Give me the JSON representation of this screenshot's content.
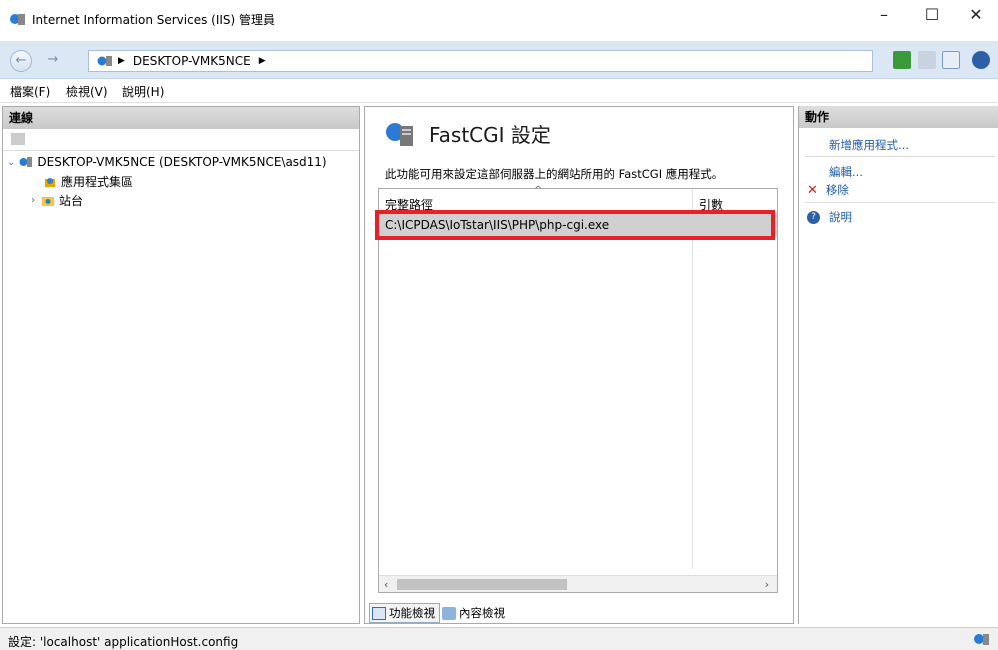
{
  "window": {
    "title": "Internet Information Services (IIS) 管理員"
  },
  "address": {
    "crumb": "DESKTOP-VMK5NCE"
  },
  "menu": [
    "檔案(F)",
    "檢視(V)",
    "說明(H)"
  ],
  "connections": {
    "header": "連線",
    "tree": {
      "server": "DESKTOP-VMK5NCE (DESKTOP-VMK5NCE\\asd11)",
      "app_pools": "應用程式集區",
      "sites": "站台"
    }
  },
  "center": {
    "title": "FastCGI 設定",
    "description": "此功能可用來設定這部伺服器上的網站所用的 FastCGI 應用程式。",
    "columns": [
      "完整路徑",
      "引數"
    ],
    "rows": [
      {
        "path": "C:\\ICPDAS\\IoTstar\\IIS\\PHP\\php-cgi.exe",
        "args": ""
      }
    ],
    "tabs": {
      "feature_view": "功能檢視",
      "content_view": "內容檢視"
    }
  },
  "actions": {
    "header": "動作",
    "add": "新增應用程式...",
    "edit": "編輯...",
    "remove": "移除",
    "help": "說明"
  },
  "status": {
    "text": "設定: 'localhost' applicationHost.config"
  },
  "colors": {
    "highlight_box": "#e8202a",
    "selected_row": "#d0d0d0",
    "link": "#1f5aa8"
  }
}
